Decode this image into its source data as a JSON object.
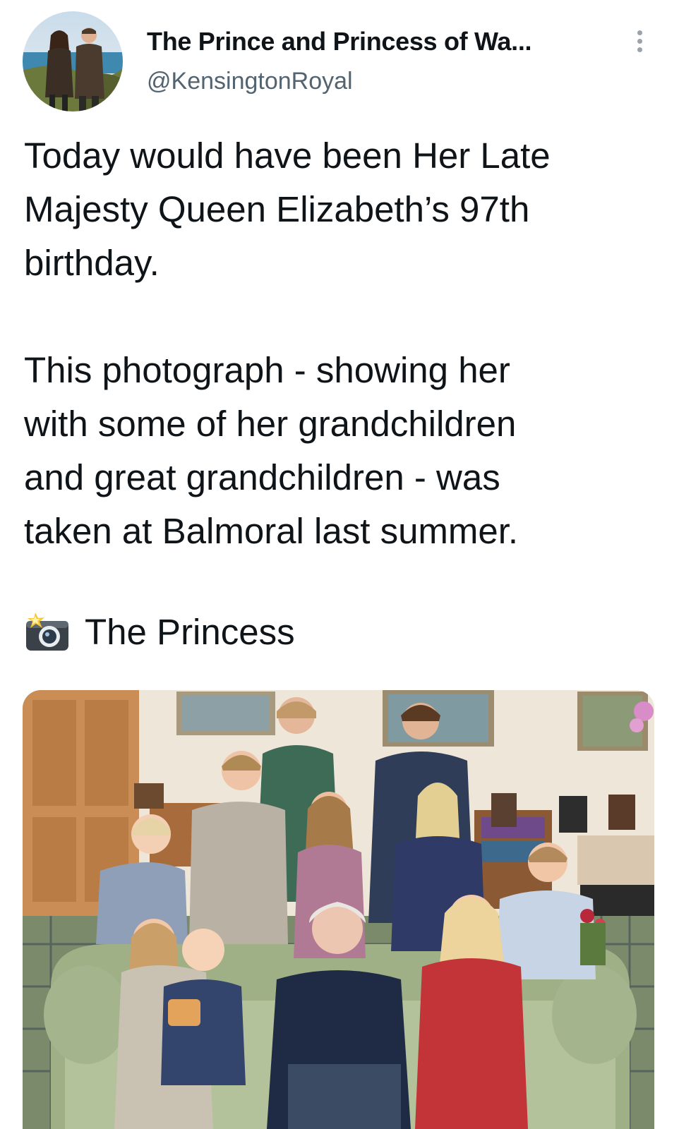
{
  "author": {
    "display_name": "The Prince and Princess of Wa...",
    "handle": "@KensingtonRoyal",
    "avatar_icon": "profile-photo-avatar"
  },
  "more_icon": "vertical-ellipsis-icon",
  "tweet": {
    "paragraphs": [
      {
        "lines": [
          "Today would have been Her Late",
          "Majesty Queen Elizabeth’s 97th",
          "birthday."
        ]
      },
      {
        "lines": [
          "This photograph - showing her",
          "with some of her grandchildren",
          "and great grandchildren - was",
          "taken at Balmoral last summer."
        ]
      }
    ],
    "credit": {
      "icon": "camera-with-flash-icon",
      "text": "The Princess"
    }
  },
  "media": {
    "type": "photo",
    "icon": "group-family-photo"
  },
  "colors": {
    "text_primary": "#0f1419",
    "text_secondary": "#536471",
    "background": "#ffffff"
  }
}
